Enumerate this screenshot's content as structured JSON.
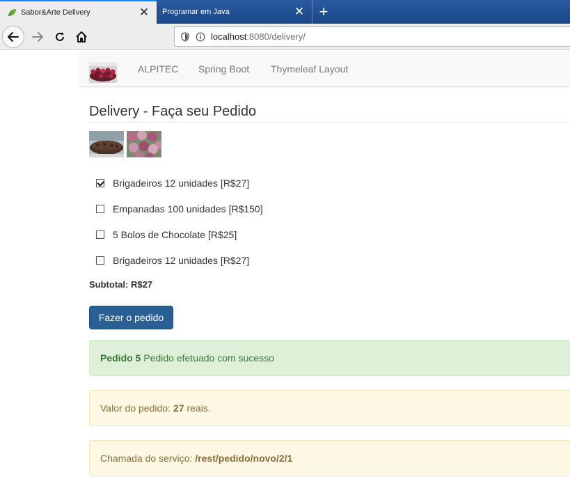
{
  "browser": {
    "tabs": [
      {
        "title": "Sabor&Arte Delivery",
        "active": true
      },
      {
        "title": "Programar em Java",
        "active": false
      }
    ],
    "url_host": "localhost",
    "url_rest": ":8080/delivery/"
  },
  "navbar": {
    "links": [
      "ALPITEC",
      "Spring Boot",
      "Thymeleaf Layout"
    ]
  },
  "page": {
    "title": "Delivery - Faça seu Pedido",
    "items": [
      {
        "label": "Brigadeiros 12 unidades [R$27]",
        "checked": true
      },
      {
        "label": "Empanadas 100 unidades [R$150]",
        "checked": false
      },
      {
        "label": "5 Bolos de Chocolate [R$25]",
        "checked": false
      },
      {
        "label": "Brigadeiros 12 unidades [R$27]",
        "checked": false
      }
    ],
    "subtotal_label": "Subtotal:",
    "subtotal_value": "R$27",
    "order_button": "Fazer o pedido"
  },
  "alerts": {
    "success_bold": "Pedido 5",
    "success_text": "Pedido efetuado com sucesso",
    "valor_prefix": "Valor do pedido:",
    "valor_bold": "27",
    "valor_suffix": "reais.",
    "chamada_prefix": "Chamada do serviço:",
    "chamada_bold": "/rest/pedido/novo/2/1"
  },
  "colors": {
    "tabstrip": "#1b478a",
    "primary_button": "#2a5f94",
    "success_bg": "#dff0d8",
    "warning_bg": "#fcf8e3"
  }
}
